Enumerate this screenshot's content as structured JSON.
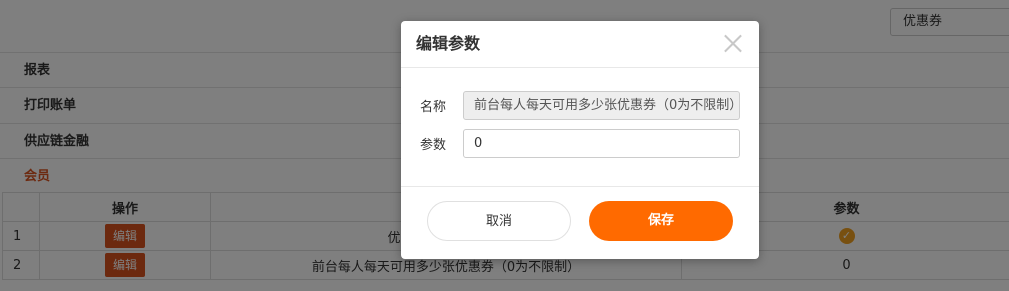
{
  "search": {
    "value": "优惠券"
  },
  "sections": [
    {
      "label": "报表"
    },
    {
      "label": "打印账单"
    },
    {
      "label": "供应链金融"
    },
    {
      "label": "会员"
    }
  ],
  "table": {
    "headers": {
      "operation": "操作",
      "param": "参数"
    },
    "rows": [
      {
        "index": "1",
        "edit": "编辑",
        "name": "优惠券到账是否发送",
        "value": ""
      },
      {
        "index": "2",
        "edit": "编辑",
        "name": "前台每人每天可用多少张优惠券（0为不限制）",
        "value": "0"
      }
    ]
  },
  "modal": {
    "title": "编辑参数",
    "name_label": "名称",
    "name_value": "前台每人每天可用多少张优惠券（0为不限制）",
    "param_label": "参数",
    "param_value": "0",
    "cancel": "取消",
    "save": "保存"
  },
  "colors": {
    "accent": "#ff6a00",
    "section_active": "#d9531e",
    "check": "#f0a020"
  }
}
